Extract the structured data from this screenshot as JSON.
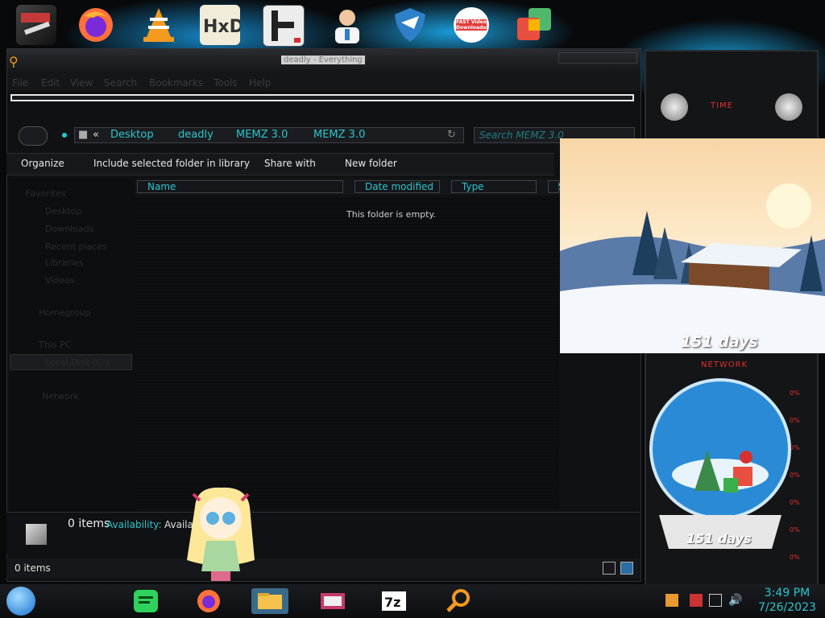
{
  "window": {
    "title": "deadly - Everything",
    "menu": [
      "File",
      "Edit",
      "View",
      "Search",
      "Bookmarks",
      "Tools",
      "Help"
    ]
  },
  "address": {
    "chevron": "«",
    "crumbs": [
      "Desktop",
      "deadly",
      "MEMZ 3.0",
      "MEMZ 3.0"
    ],
    "search_placeholder": "Search MEMZ 3.0"
  },
  "toolbar": {
    "organize": "Organize",
    "include": "Include selected folder in library",
    "share": "Share with",
    "new_folder": "New folder"
  },
  "columns": [
    "Name",
    "Date modified",
    "Type",
    "Si"
  ],
  "content": {
    "empty_message": "This folder is empty."
  },
  "nav": {
    "items": [
      "Favorites",
      "Desktop",
      "Downloads",
      "Recent places",
      "Libraries",
      "Videos",
      "Homegroup",
      "This PC",
      "Local Disk (C:)",
      "Network"
    ]
  },
  "details": {
    "count": "0 items",
    "availability_label": "Availability:",
    "availability_value": "Availa"
  },
  "status": {
    "count": "0 items"
  },
  "widgets": {
    "time_label": "TIME",
    "network_label": "NETWORK",
    "days_countdown_1": "151 days",
    "days_countdown_2": "151 days",
    "net_readouts": [
      "0%",
      "0%",
      "0%",
      "0%",
      "0%",
      "0%",
      "0%"
    ]
  },
  "desktop_icons": [
    {
      "name": "tools-icon",
      "color": "#c43a3a"
    },
    {
      "name": "firefox-icon",
      "color": "#ff6b2a"
    },
    {
      "name": "vlc-icon",
      "color": "#f39a1f"
    },
    {
      "name": "hxd-icon",
      "color": "#d9b26b"
    },
    {
      "name": "hlsw-icon",
      "color": "#3a3a3a"
    },
    {
      "name": "doctor-icon",
      "color": "#f0c79e"
    },
    {
      "name": "shield-icon",
      "color": "#2e80c8"
    },
    {
      "name": "fast-video-downloader-icon",
      "color": "#e33b3b"
    },
    {
      "name": "app-tiles-icon",
      "color": "#46b36a"
    }
  ],
  "fast_video_text": "FAST Video Downloader",
  "taskbar": {
    "time": "3:49 PM",
    "date": "7/26/2023"
  }
}
